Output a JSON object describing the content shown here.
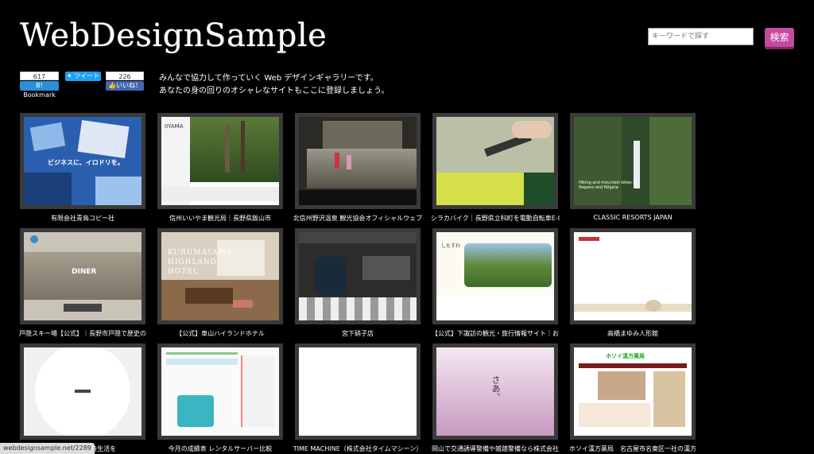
{
  "header": {
    "logo": "WebDesignSample",
    "search_placeholder": "キーワードで探す",
    "search_button": "検索"
  },
  "share": {
    "hatena_count": "617",
    "hatena_label": "B! Bookmark",
    "tweet_label": "ツイート",
    "like_count": "226",
    "like_label": "いいね！"
  },
  "intro": {
    "line1": "みんなで協力して作っていく Web デザインギャラリーです。",
    "line2": "あなたの身の回りのオシャレなサイトもここに登録しましょう。"
  },
  "gallery": [
    {
      "caption": "有限会社青鳥コピー社",
      "thumb_text": "ビジネスに、イロドリを。"
    },
    {
      "caption": "信州いいやま観光局｜長野県飯山市",
      "thumb_text": "IIYAMA"
    },
    {
      "caption": "北信州野沢温泉 観光協会オフィシャルウェブ",
      "thumb_text": ""
    },
    {
      "caption": "シラカバイク｜長野県立科町を電動自転車E-I",
      "thumb_text": ""
    },
    {
      "caption": "CLASSIC RESORTS JAPAN",
      "thumb_text": "Hiking and mountain bikes in Nagano and Niigata"
    },
    {
      "caption": "戸隠スキー場【公式】｜長野市戸隠で歴史の",
      "thumb_text": "DINER"
    },
    {
      "caption": "【公式】車山ハイランドホテル",
      "thumb_text": "KURUMAYAMA HIGHLAND HOTEL"
    },
    {
      "caption": "宮下硝子店",
      "thumb_text": ""
    },
    {
      "caption": "【公式】下諏訪の観光・旅行情報サイト｜お",
      "thumb_text": "しもすわ"
    },
    {
      "caption": "高橋まゆみ人形館",
      "thumb_text": ""
    },
    {
      "caption": "okudake で防音生活を",
      "thumb_text": ""
    },
    {
      "caption": "今月の成績表 レンタルサーバー比較",
      "thumb_text": ""
    },
    {
      "caption": "TIME MACHINE（株式会社タイムマシーン）",
      "thumb_text": ""
    },
    {
      "caption": "岡山で交通誘導警備や雑踏警備なら株式会社",
      "thumb_text": "さあ、"
    },
    {
      "caption": "ホソイ漢方薬局　名古屋市名東区一社の漢方",
      "thumb_text": "ホソイ漢方薬局"
    }
  ],
  "status_url": "webdesignsample.net/2289"
}
